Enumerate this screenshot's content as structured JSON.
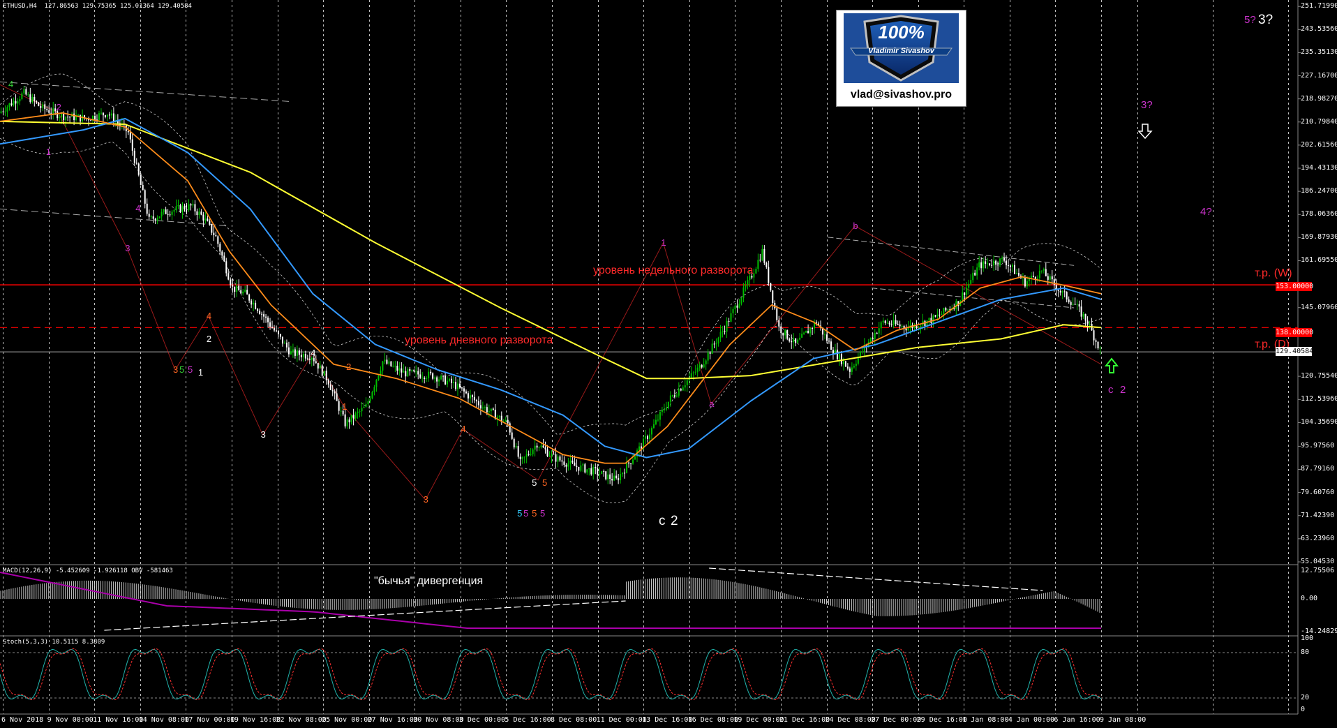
{
  "header": {
    "symbol": "ETHUSD,H4",
    "ohlc": "127.86563 129.75365 125.01364 129.40584",
    "macd_info": "MACD(12,26,9) -5.452609 -1.926118 OBV -581463",
    "stoch_info": "Stoch(5,3,3) 10.5115 8.3809"
  },
  "logo": {
    "badge": "100%",
    "name": "Vladimir Sivashov",
    "email": "vlad@sivashov.pro"
  },
  "annotations": {
    "weekly_level": "уровень недельного разворота",
    "daily_level": "уровень дневного разворота",
    "tp_w": "т.р. (W)",
    "tp_d": "т.р. (D)",
    "divergence": "\"бычья\" дивергенция",
    "big_c": "c",
    "big_2": "2",
    "top_5": "5?",
    "top_3": "3?",
    "mid_3": "3?",
    "mid_4": "4?",
    "end_c": "c",
    "end_2": "2"
  },
  "price_tags": {
    "weekly": "153.00000",
    "daily": "138.00000",
    "current": "129.40584"
  },
  "colors": {
    "background": "#000000",
    "bull_candle": "#00c000",
    "bear_candle": "#ffffff",
    "ma_fast": "#ff8c1a",
    "ma_mid": "#3399ff",
    "ma_slow": "#ffff33",
    "level_line": "#ff0000",
    "wave_purple": "#cc33cc",
    "wave_green": "#33cc33",
    "wave_orange": "#ff6622",
    "wave_cyan": "#33ccff",
    "macd_signal": "#aa00aa",
    "stoch_main": "#20b2aa",
    "stoch_signal": "#ff3030"
  },
  "chart_data": {
    "type": "candlestick",
    "instrument": "ETHUSD",
    "timeframe": "H4",
    "y_ticks": [
      "251.71990",
      "243.53560",
      "235.35130",
      "227.16700",
      "218.98270",
      "210.79840",
      "202.61560",
      "194.43130",
      "186.24700",
      "178.06360",
      "169.87930",
      "161.69550",
      "153.00000",
      "145.07960",
      "138.00000",
      "129.40584",
      "120.75540",
      "112.53960",
      "104.35690",
      "95.97560",
      "87.79160",
      "79.60760",
      "71.42390",
      "63.23960",
      "55.04530"
    ],
    "y_range": [
      55.0453,
      253.0
    ],
    "x_ticks": [
      "6 Nov 2018",
      "9 Nov 00:00",
      "11 Nov 16:00",
      "14 Nov 08:00",
      "17 Nov 00:00",
      "19 Nov 16:00",
      "22 Nov 08:00",
      "25 Nov 00:00",
      "27 Nov 16:00",
      "30 Nov 08:00",
      "3 Dec 00:00",
      "5 Dec 16:00",
      "8 Dec 08:00",
      "11 Dec 00:00",
      "13 Dec 16:00",
      "16 Dec 08:00",
      "19 Dec 00:00",
      "21 Dec 16:00",
      "24 Dec 08:00",
      "27 Dec 00:00",
      "29 Dec 16:00",
      "1 Jan 08:00",
      "4 Jan 00:00",
      "6 Jan 16:00",
      "9 Jan 08:00"
    ],
    "price_path": [
      [
        0,
        214
      ],
      [
        12,
        221
      ],
      [
        20,
        216
      ],
      [
        30,
        213
      ],
      [
        42,
        212
      ],
      [
        52,
        214
      ],
      [
        62,
        207
      ],
      [
        72,
        176
      ],
      [
        80,
        179
      ],
      [
        92,
        181
      ],
      [
        98,
        177
      ],
      [
        104,
        170
      ],
      [
        112,
        152
      ],
      [
        118,
        150
      ],
      [
        124,
        145
      ],
      [
        130,
        139
      ],
      [
        140,
        129
      ],
      [
        150,
        128
      ],
      [
        158,
        119
      ],
      [
        166,
        104
      ],
      [
        176,
        110
      ],
      [
        184,
        126
      ],
      [
        194,
        122
      ],
      [
        208,
        121
      ],
      [
        218,
        118
      ],
      [
        232,
        110
      ],
      [
        244,
        104
      ],
      [
        250,
        90
      ],
      [
        258,
        97
      ],
      [
        266,
        92
      ],
      [
        276,
        89
      ],
      [
        286,
        87
      ],
      [
        296,
        84
      ],
      [
        308,
        96
      ],
      [
        322,
        113
      ],
      [
        336,
        124
      ],
      [
        348,
        138
      ],
      [
        360,
        155
      ],
      [
        366,
        165
      ],
      [
        374,
        138
      ],
      [
        382,
        132
      ],
      [
        392,
        140
      ],
      [
        400,
        130
      ],
      [
        408,
        123
      ],
      [
        416,
        132
      ],
      [
        424,
        140
      ],
      [
        436,
        138
      ],
      [
        448,
        141
      ],
      [
        460,
        147
      ],
      [
        470,
        160
      ],
      [
        482,
        162
      ],
      [
        492,
        154
      ],
      [
        500,
        158
      ],
      [
        510,
        150
      ],
      [
        516,
        146
      ],
      [
        522,
        140
      ],
      [
        528,
        130
      ]
    ],
    "ma_fast": [
      [
        0,
        211
      ],
      [
        30,
        214
      ],
      [
        60,
        209
      ],
      [
        90,
        190
      ],
      [
        110,
        165
      ],
      [
        130,
        146
      ],
      [
        160,
        125
      ],
      [
        190,
        120
      ],
      [
        220,
        113
      ],
      [
        250,
        101
      ],
      [
        270,
        93
      ],
      [
        290,
        90
      ],
      [
        300,
        90
      ],
      [
        320,
        103
      ],
      [
        350,
        132
      ],
      [
        370,
        146
      ],
      [
        390,
        140
      ],
      [
        410,
        130
      ],
      [
        430,
        137
      ],
      [
        450,
        141
      ],
      [
        470,
        152
      ],
      [
        490,
        156
      ],
      [
        510,
        153
      ],
      [
        528,
        150
      ]
    ],
    "ma_mid": [
      [
        0,
        203
      ],
      [
        40,
        208
      ],
      [
        60,
        212
      ],
      [
        90,
        200
      ],
      [
        120,
        180
      ],
      [
        150,
        150
      ],
      [
        180,
        132
      ],
      [
        210,
        123
      ],
      [
        240,
        116
      ],
      [
        270,
        107
      ],
      [
        290,
        96
      ],
      [
        310,
        92
      ],
      [
        330,
        95
      ],
      [
        360,
        112
      ],
      [
        390,
        127
      ],
      [
        420,
        132
      ],
      [
        450,
        140
      ],
      [
        480,
        148
      ],
      [
        510,
        152
      ],
      [
        528,
        148
      ]
    ],
    "ma_slow": [
      [
        0,
        211
      ],
      [
        60,
        210
      ],
      [
        120,
        193
      ],
      [
        180,
        168
      ],
      [
        240,
        145
      ],
      [
        290,
        127
      ],
      [
        310,
        120
      ],
      [
        330,
        120
      ],
      [
        360,
        121
      ],
      [
        400,
        126
      ],
      [
        440,
        131
      ],
      [
        480,
        134
      ],
      [
        510,
        139
      ],
      [
        528,
        138
      ]
    ],
    "wave_labels": [
      {
        "t": 5,
        "p": 224,
        "text": "4",
        "color": "green"
      },
      {
        "t": 28,
        "p": 216,
        "text": "2",
        "color": "purple"
      },
      {
        "t": 23,
        "p": 200,
        "text": "1",
        "color": "purple"
      },
      {
        "t": 66,
        "p": 180,
        "text": "4",
        "color": "purple"
      },
      {
        "t": 61,
        "p": 166,
        "text": "3",
        "color": "purple"
      },
      {
        "t": 100,
        "p": 142,
        "text": "4",
        "color": "orange"
      },
      {
        "t": 100,
        "p": 134,
        "text": "2",
        "color": "white"
      },
      {
        "t": 84,
        "p": 123,
        "text": "3",
        "color": "orange"
      },
      {
        "t": 87,
        "p": 123,
        "text": "5",
        "color": "green"
      },
      {
        "t": 91,
        "p": 123,
        "text": "5",
        "color": "purple"
      },
      {
        "t": 96,
        "p": 122,
        "text": "1",
        "color": "white"
      },
      {
        "t": 150,
        "p": 129,
        "text": "4",
        "color": "white"
      },
      {
        "t": 126,
        "p": 100,
        "text": "3",
        "color": "white"
      },
      {
        "t": 167,
        "p": 124,
        "text": "2",
        "color": "orange"
      },
      {
        "t": 165,
        "p": 110,
        "text": "1",
        "color": "orange"
      },
      {
        "t": 222,
        "p": 102,
        "text": "4",
        "color": "orange"
      },
      {
        "t": 204,
        "p": 77,
        "text": "3",
        "color": "orange"
      },
      {
        "t": 256,
        "p": 83,
        "text": "5",
        "color": "white"
      },
      {
        "t": 261,
        "p": 83,
        "text": "5",
        "color": "orange"
      },
      {
        "t": 249,
        "p": 72,
        "text": "5",
        "color": "cyan"
      },
      {
        "t": 252,
        "p": 72,
        "text": "5",
        "color": "purple"
      },
      {
        "t": 256,
        "p": 72,
        "text": "5",
        "color": "orange"
      },
      {
        "t": 260,
        "p": 72,
        "text": "5",
        "color": "purple"
      },
      {
        "t": 318,
        "p": 168,
        "text": "1",
        "color": "purple"
      },
      {
        "t": 341,
        "p": 111,
        "text": "a",
        "color": "purple"
      },
      {
        "t": 410,
        "p": 174,
        "text": "b",
        "color": "purple"
      }
    ],
    "macd_histogram": "values from -14.248297 to 12.75506",
    "macd_ticks": [
      "12.75506",
      "0.00",
      "-14.248297"
    ],
    "stoch_ticks": [
      "100",
      "80",
      "20",
      "0"
    ]
  }
}
